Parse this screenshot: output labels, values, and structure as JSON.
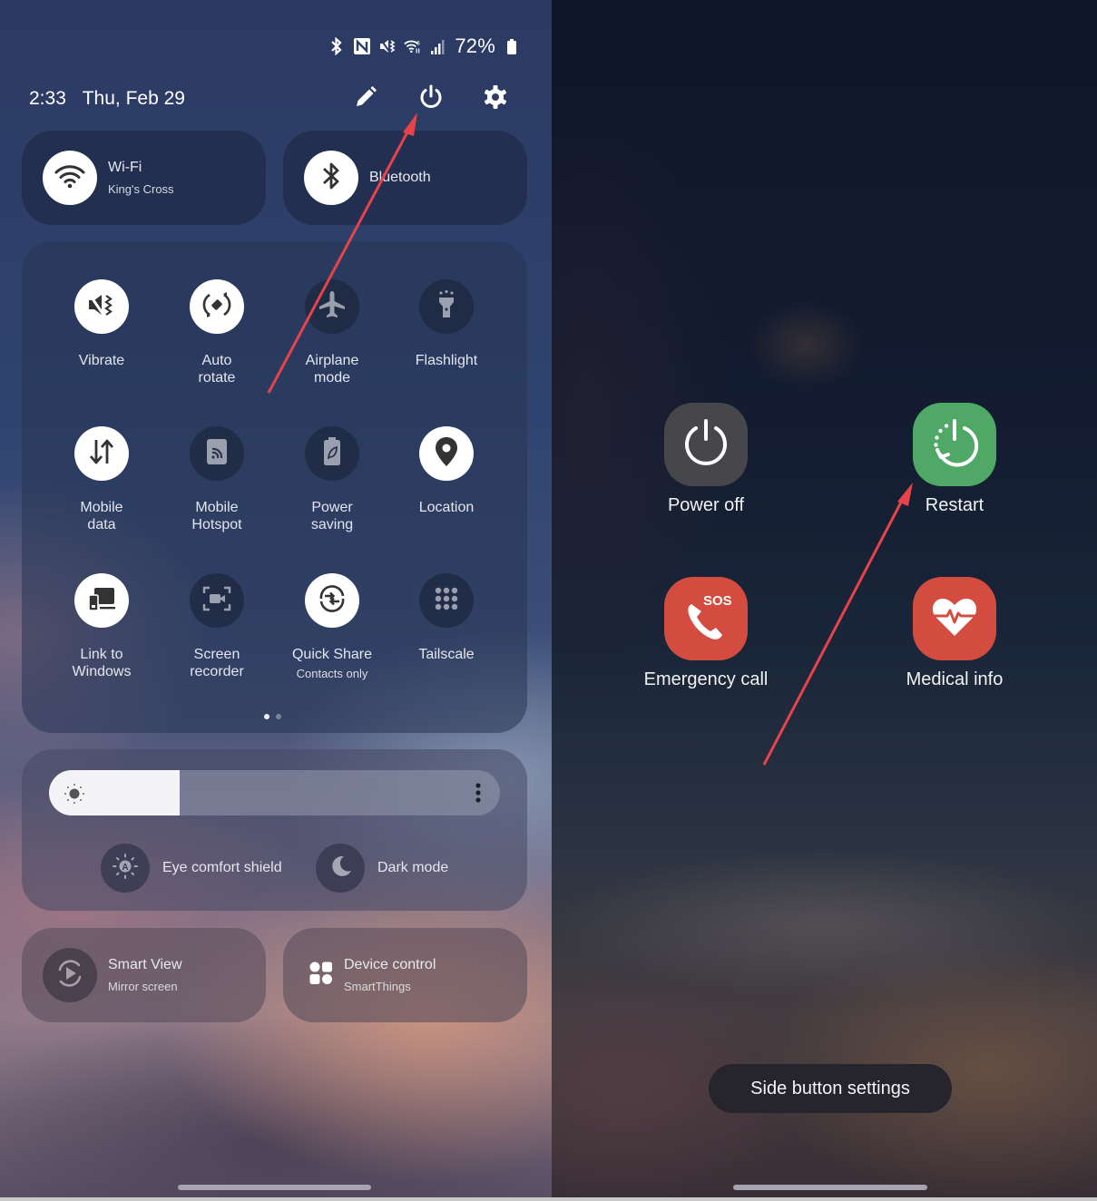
{
  "quick_panel": {
    "status_bar": {
      "icons": [
        "bluetooth-icon",
        "nfc-icon",
        "vibrate-icon",
        "wifi6-icon",
        "signal-icon"
      ],
      "battery_percent": "72%",
      "battery_level": 0.72
    },
    "header": {
      "time": "2:33",
      "date": "Thu, Feb 29",
      "actions": [
        "edit-icon",
        "power-icon",
        "settings-icon"
      ]
    },
    "wide_tiles": [
      {
        "label": "Wi-Fi",
        "sublabel": "King's Cross",
        "icon": "wifi-icon",
        "state": "on"
      },
      {
        "label": "Bluetooth",
        "sublabel": "",
        "icon": "bluetooth-icon",
        "state": "on"
      }
    ],
    "tiles": [
      {
        "label": "Vibrate",
        "sublabel": "",
        "icon": "vibrate-icon",
        "state": "on"
      },
      {
        "label": "Auto rotate",
        "sublabel": "",
        "icon": "auto-rotate-icon",
        "state": "on"
      },
      {
        "label": "Airplane mode",
        "sublabel": "",
        "icon": "airplane-icon",
        "state": "off"
      },
      {
        "label": "Flashlight",
        "sublabel": "",
        "icon": "flashlight-icon",
        "state": "off"
      },
      {
        "label": "Mobile data",
        "sublabel": "",
        "icon": "mobile-data-icon",
        "state": "on"
      },
      {
        "label": "Mobile Hotspot",
        "sublabel": "",
        "icon": "hotspot-icon",
        "state": "off"
      },
      {
        "label": "Power saving",
        "sublabel": "",
        "icon": "power-saving-icon",
        "state": "off"
      },
      {
        "label": "Location",
        "sublabel": "",
        "icon": "location-icon",
        "state": "on"
      },
      {
        "label": "Link to Windows",
        "sublabel": "",
        "icon": "link-to-windows-icon",
        "state": "on"
      },
      {
        "label": "Screen recorder",
        "sublabel": "",
        "icon": "screen-recorder-icon",
        "state": "off"
      },
      {
        "label": "Quick Share",
        "sublabel": "Contacts only",
        "icon": "quick-share-icon",
        "state": "on"
      },
      {
        "label": "Tailscale",
        "sublabel": "",
        "icon": "tailscale-icon",
        "state": "off"
      }
    ],
    "pager": {
      "current_page": 1,
      "total_pages": 2
    },
    "brightness": {
      "level": 0.29,
      "more_icon": "more-vertical-icon"
    },
    "toggles": [
      {
        "label": "Eye comfort shield",
        "icon": "eye-comfort-icon"
      },
      {
        "label": "Dark mode",
        "icon": "moon-icon"
      }
    ],
    "bottom_tiles": [
      {
        "label": "Smart View",
        "sublabel": "Mirror screen",
        "icon": "smart-view-icon"
      },
      {
        "label": "Device control",
        "sublabel": "SmartThings",
        "icon": "device-control-icon"
      }
    ]
  },
  "power_menu": {
    "options": [
      {
        "label": "Power off",
        "icon": "power-off-icon",
        "color": "#47474b"
      },
      {
        "label": "Restart",
        "icon": "restart-icon",
        "color": "#4fa866"
      },
      {
        "label": "Emergency call",
        "icon": "emergency-call-icon",
        "color": "#d34c3f",
        "badge": "SOS"
      },
      {
        "label": "Medical info",
        "icon": "medical-info-icon",
        "color": "#d34c3f"
      }
    ],
    "side_button_settings": "Side button settings"
  },
  "annotations": {
    "arrow_color": "#e8424a"
  }
}
